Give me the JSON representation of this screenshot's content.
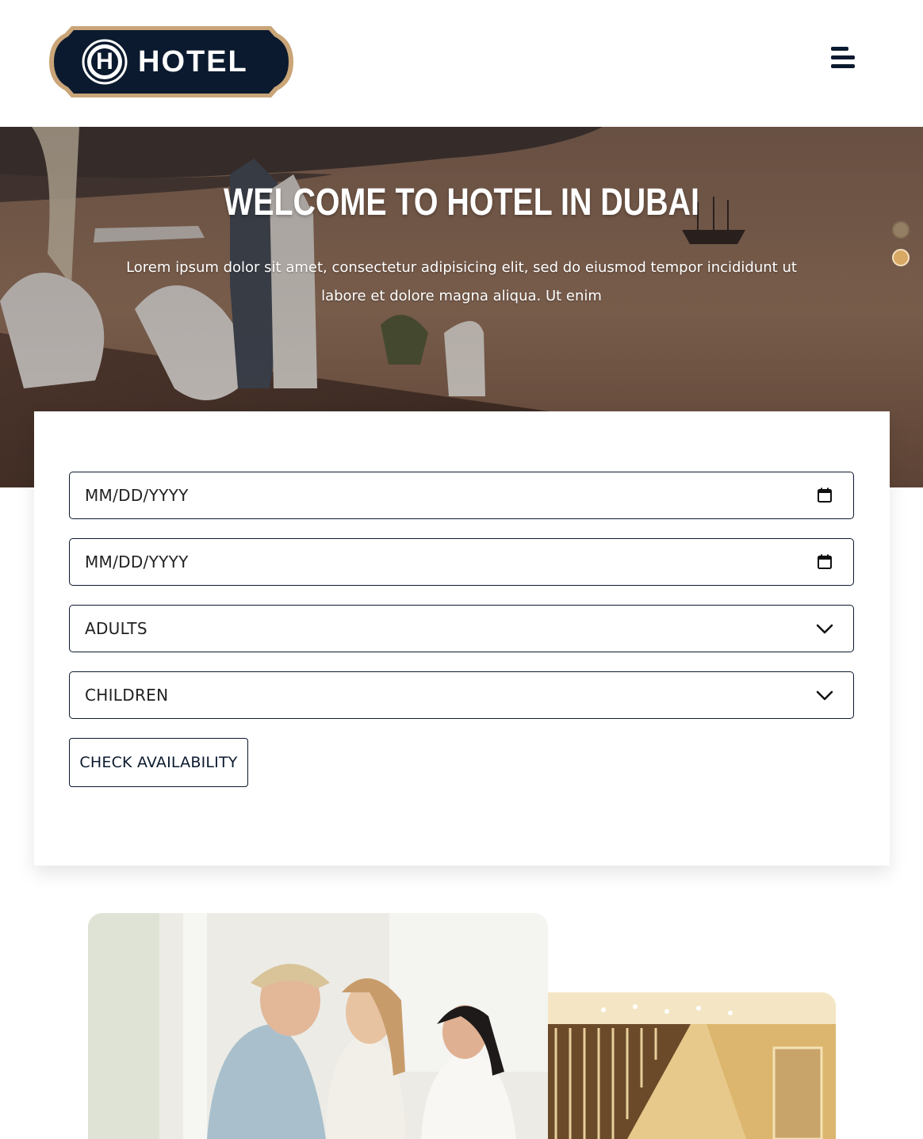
{
  "header": {
    "logo_text": "HOTEL",
    "logo_icon": "H",
    "menu_icon": "hamburger-menu-icon"
  },
  "hero": {
    "title": "WELCOME TO HOTEL IN DUBAI",
    "subtitle": "Lorem ipsum dolor sit amet, consectetur adipisicing elit, sed do eiusmod tempor incididunt ut labore et dolore magna aliqua. Ut enim",
    "slides_count": 2,
    "active_slide": 2
  },
  "booking": {
    "check_in_placeholder": "MM/DD/YYYY",
    "check_out_placeholder": "MM/DD/YYYY",
    "adults_label": "ADULTS",
    "children_label": "CHILDREN",
    "submit_label": "CHECK AVAILABILITY"
  },
  "colors": {
    "navy": "#0b1a2e",
    "gold": "#d8a865",
    "white": "#ffffff"
  },
  "icons": {
    "date": "calendar-icon",
    "select": "chevron-down-icon"
  }
}
